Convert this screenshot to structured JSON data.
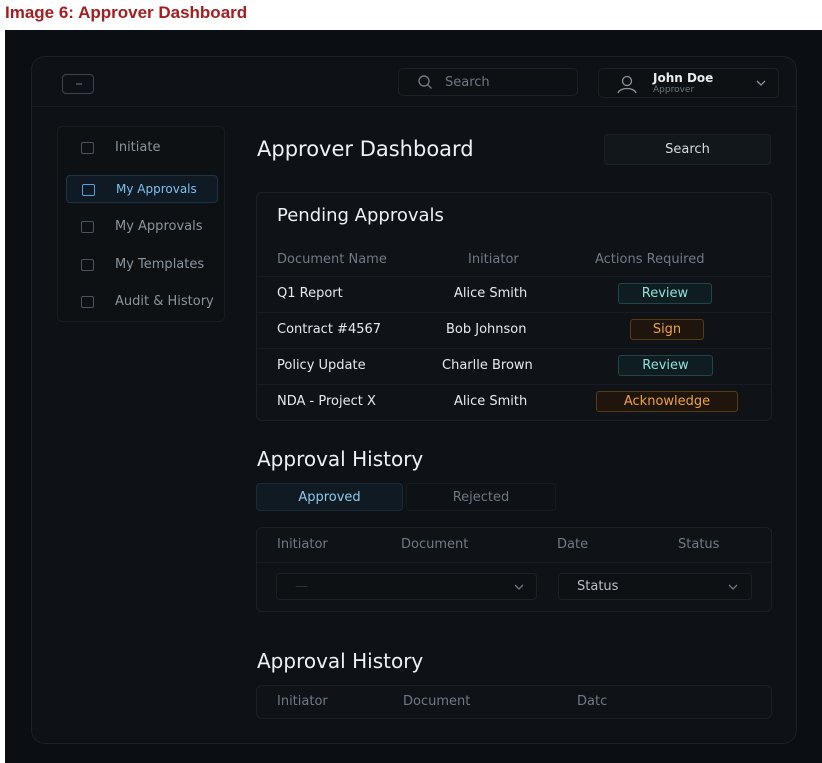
{
  "caption": "Image 6: Approver Dashboard",
  "header": {
    "search_placeholder": "Search",
    "user": {
      "name": "John Doe",
      "role": "Approver"
    }
  },
  "sidebar": {
    "items": [
      {
        "label": "Initiate",
        "icon": "document-icon",
        "active": false
      },
      {
        "label": "My Approvals",
        "icon": "check-square-icon",
        "active": true
      },
      {
        "label": "My Approvals",
        "icon": "check-square-icon",
        "active": false
      },
      {
        "label": "My Templates",
        "icon": "template-icon",
        "active": false
      },
      {
        "label": "Audit & History",
        "icon": "history-icon",
        "active": false
      }
    ]
  },
  "main": {
    "title": "Approver Dashboard",
    "search_button": "Search",
    "pending": {
      "title": "Pending Approvals",
      "columns": [
        "Document Name",
        "Initiator",
        "Actions Required"
      ],
      "rows": [
        {
          "document": "Q1 Report",
          "initiator": "Alice Smith",
          "action": "Review",
          "action_type": "review"
        },
        {
          "document": "Contract #4567",
          "initiator": "Bob Johnson",
          "action": "Sign",
          "action_type": "sign"
        },
        {
          "document": "Policy Update",
          "initiator": "Charlle Brown",
          "action": "Review",
          "action_type": "review"
        },
        {
          "document": "NDA - Project X",
          "initiator": "Alice Smith",
          "action": "Acknowledge",
          "action_type": "sign"
        }
      ]
    },
    "history1": {
      "title": "Approval History",
      "tabs": [
        "Approved",
        "Rejected"
      ],
      "columns": [
        "Initiator",
        "Document",
        "Date",
        "Status"
      ],
      "filter_left_value": "—",
      "filter_right_value": "Status"
    },
    "history2": {
      "title": "Approval History",
      "columns": [
        "Initiator",
        "Document",
        "Datc"
      ]
    }
  },
  "colors": {
    "background": "#0b0e12",
    "accent_blue": "#7ec0ee",
    "review_teal": "#8fe0dc",
    "sign_orange": "#f0a23e",
    "caption_red": "#a51d1d"
  }
}
